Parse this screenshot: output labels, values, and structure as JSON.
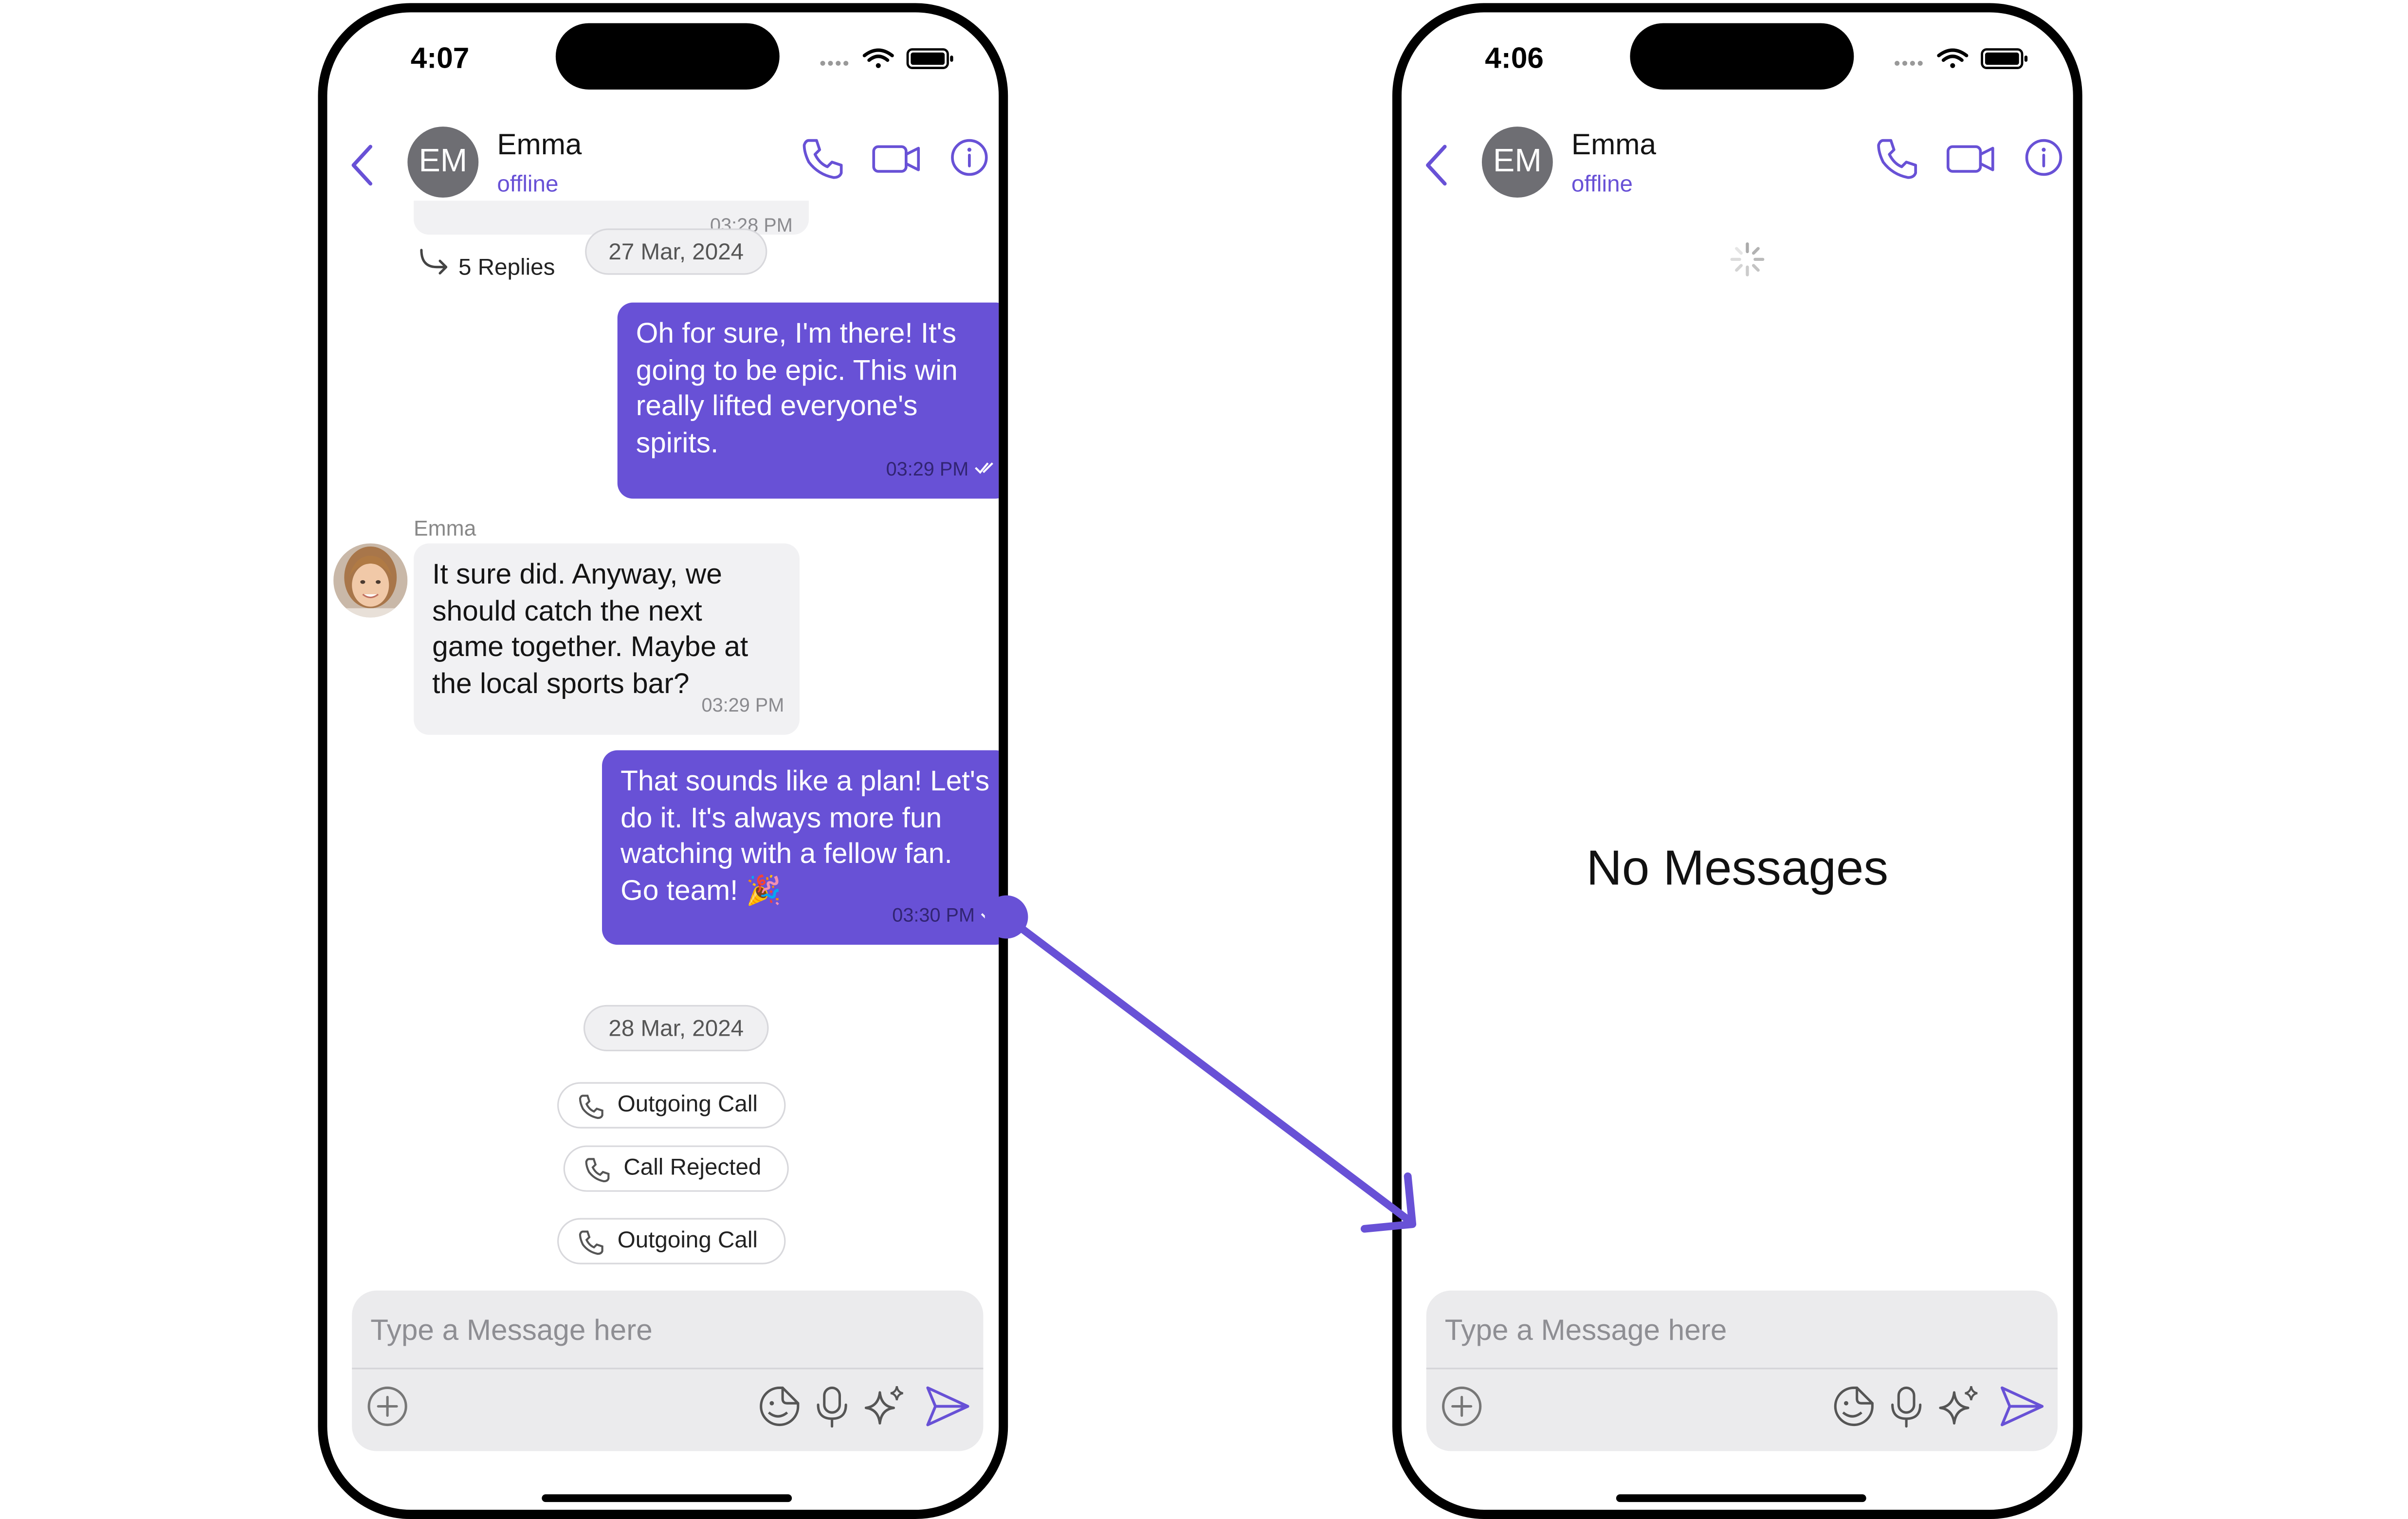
{
  "left_screen": {
    "status_time": "4:07",
    "header": {
      "avatar_initials": "EM",
      "name": "Emma",
      "status": "offline"
    },
    "thread": {
      "partial_time": "03:28 PM",
      "replies_label": "5 Replies"
    },
    "date_1": "27 Mar, 2024",
    "messages": [
      {
        "direction": "outgoing",
        "text": "Oh for sure, I'm there! It's going to be epic. This win really lifted everyone's spirits.",
        "time": "03:29 PM"
      },
      {
        "direction": "incoming",
        "sender": "Emma",
        "text": "It sure did. Anyway, we should catch the next game together. Maybe at the local sports bar?",
        "time": "03:29 PM"
      },
      {
        "direction": "outgoing",
        "text": "That sounds like a plan! Let's do it. It's always more fun watching with a fellow fan. Go team! 🎉",
        "time": "03:30 PM"
      }
    ],
    "date_2": "28 Mar, 2024",
    "calls": [
      "Outgoing Call",
      "Call Rejected",
      "Outgoing Call"
    ],
    "composer": {
      "placeholder": "Type a Message here"
    }
  },
  "right_screen": {
    "status_time": "4:06",
    "header": {
      "avatar_initials": "EM",
      "name": "Emma",
      "status": "offline"
    },
    "empty_state": "No Messages",
    "composer": {
      "placeholder": "Type a Message here"
    }
  },
  "icons": [
    "back-chevron-icon",
    "phone-icon",
    "video-icon",
    "info-icon",
    "reply-arrow-icon",
    "check-icon",
    "plus-icon",
    "sticker-icon",
    "mic-icon",
    "sparkle-icon",
    "send-icon",
    "spinner-icon",
    "wifi-icon",
    "battery-icon",
    "signal-icon"
  ],
  "colors": {
    "accent": "#6851d6",
    "incoming_bubble": "#f1f1f3",
    "composer": "#ebebed"
  }
}
